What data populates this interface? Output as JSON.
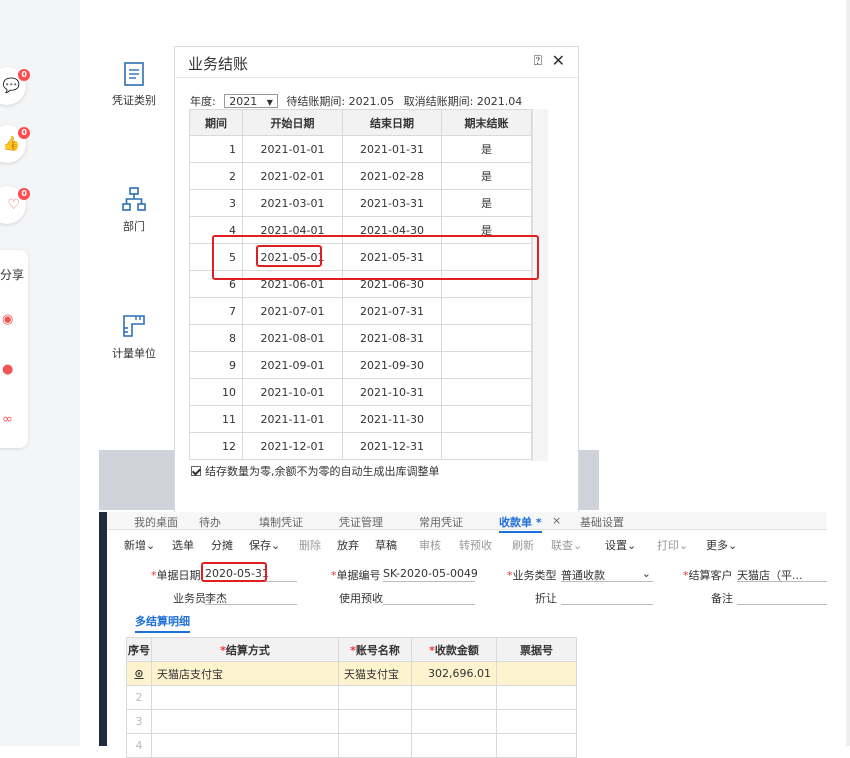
{
  "sidebar_social": {
    "badges": [
      "0",
      "0",
      "0"
    ],
    "share_label": "分享"
  },
  "app1": {
    "nav": [
      "凭证类别",
      "部门",
      "计量单位"
    ]
  },
  "dialog": {
    "title": "业务结账",
    "year_label": "年度:",
    "year_value": "2021",
    "pending_period_label": "待结账期间:",
    "pending_period": "2021.05",
    "cancel_period_label": "取消结账期间:",
    "cancel_period": "2021.04",
    "columns": [
      "期间",
      "开始日期",
      "结束日期",
      "期末结账"
    ],
    "rows": [
      [
        "1",
        "2021-01-01",
        "2021-01-31",
        "是"
      ],
      [
        "2",
        "2021-02-01",
        "2021-02-28",
        "是"
      ],
      [
        "3",
        "2021-03-01",
        "2021-03-31",
        "是"
      ],
      [
        "4",
        "2021-04-01",
        "2021-04-30",
        "是"
      ],
      [
        "5",
        "2021-05-01",
        "2021-05-31",
        ""
      ],
      [
        "6",
        "2021-06-01",
        "2021-06-30",
        ""
      ],
      [
        "7",
        "2021-07-01",
        "2021-07-31",
        ""
      ],
      [
        "8",
        "2021-08-01",
        "2021-08-31",
        ""
      ],
      [
        "9",
        "2021-09-01",
        "2021-09-30",
        ""
      ],
      [
        "10",
        "2021-10-01",
        "2021-10-31",
        ""
      ],
      [
        "11",
        "2021-11-01",
        "2021-11-30",
        ""
      ],
      [
        "12",
        "2021-12-01",
        "2021-12-31",
        ""
      ]
    ],
    "checkbox_label": "结存数量为零,余额不为零的自动生成出库调整单"
  },
  "app2": {
    "tabs": [
      "我的桌面",
      "待办",
      "填制凭证",
      "凭证管理",
      "常用凭证",
      "收款单 *",
      "×",
      "基础设置"
    ],
    "toolbar": [
      "新增",
      "选单",
      "分摊",
      "保存",
      "删除",
      "放弃",
      "草稿",
      "审核",
      "转预收",
      "刷新",
      "联查",
      "设置",
      "打印",
      "更多"
    ],
    "form": {
      "date_label": "单据日期",
      "date_value": "2020-05-31",
      "no_label": "单据编号",
      "no_value": "SK-2020-05-0049",
      "type_label": "业务类型",
      "type_value": "普通收款",
      "customer_label": "结算客户",
      "customer_value": "天猫店（平...",
      "clerk_label": "业务员",
      "clerk_value": "李杰",
      "prepay_label": "使用预收",
      "discount_label": "折让",
      "remark_label": "备注"
    },
    "subtab": "多结算明细",
    "detail_columns": [
      "序号",
      "结算方式",
      "账号名称",
      "收款金额",
      "票据号"
    ],
    "detail_rows": [
      [
        "",
        "天猫店支付宝",
        "天猫支付宝",
        "302,696.01",
        ""
      ],
      [
        "2",
        "",
        "",
        "",
        ""
      ],
      [
        "3",
        "",
        "",
        "",
        ""
      ],
      [
        "4",
        "",
        "",
        "",
        ""
      ]
    ]
  }
}
